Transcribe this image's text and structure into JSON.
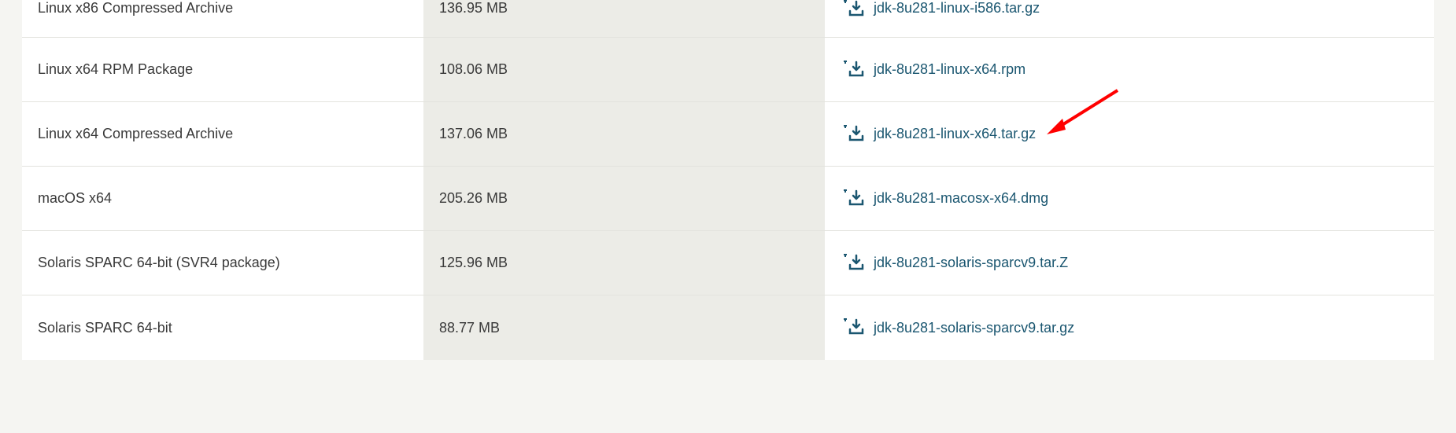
{
  "colors": {
    "link": "#1a5670",
    "arrow": "#ff0000"
  },
  "downloads": [
    {
      "product": "Linux x86 Compressed Archive",
      "size": "136.95 MB",
      "filename": "jdk-8u281-linux-i586.tar.gz"
    },
    {
      "product": "Linux x64 RPM Package",
      "size": "108.06 MB",
      "filename": "jdk-8u281-linux-x64.rpm"
    },
    {
      "product": "Linux x64 Compressed Archive",
      "size": "137.06 MB",
      "filename": "jdk-8u281-linux-x64.tar.gz"
    },
    {
      "product": "macOS x64",
      "size": "205.26 MB",
      "filename": "jdk-8u281-macosx-x64.dmg"
    },
    {
      "product": "Solaris SPARC 64-bit (SVR4 package)",
      "size": "125.96 MB",
      "filename": "jdk-8u281-solaris-sparcv9.tar.Z"
    },
    {
      "product": "Solaris SPARC 64-bit",
      "size": "88.77 MB",
      "filename": "jdk-8u281-solaris-sparcv9.tar.gz"
    }
  ]
}
